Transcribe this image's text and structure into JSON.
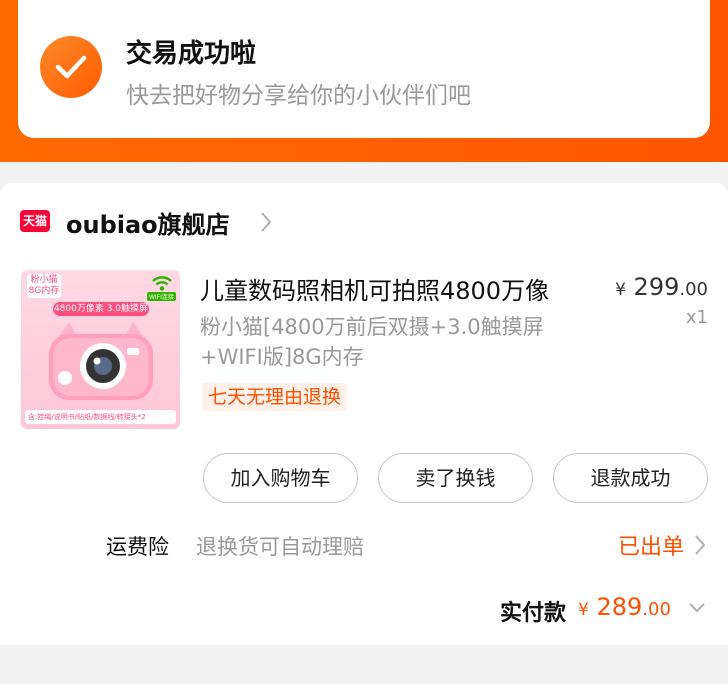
{
  "success": {
    "title": "交易成功啦",
    "subtitle": "快去把好物分享给你的小伙伴们吧"
  },
  "store": {
    "logo_text": "天猫",
    "name": "oubiao旗舰店"
  },
  "product": {
    "image": {
      "brand_line1": "粉小猫",
      "brand_line2": "8G内存",
      "badge": "4800万像素 3.0触摸屏",
      "wifi_label": "WIFI连接",
      "caption": "含:挂绳/说明书/贴纸/数据线/转接头*2"
    },
    "title": "儿童数码照相机可拍照4800万像",
    "sku": "粉小猫[4800万前后双摄+3.0触摸屏+WIFI版]8G内存",
    "return_tag": "七天无理由退换",
    "price_currency": "¥",
    "price_int": "299",
    "price_dec": ".00",
    "quantity": "x1"
  },
  "actions": {
    "add_to_cart": "加入购物车",
    "sell": "卖了换钱",
    "refund": "退款成功"
  },
  "insurance": {
    "label": "运费险",
    "description": "退换货可自动理赔",
    "status": "已出单"
  },
  "payment": {
    "label": "实付款",
    "currency": "¥",
    "amount_int": "289",
    "amount_dec": ".00"
  },
  "icons": {
    "success": "check-icon",
    "store_chevron": "chevron-right-icon",
    "insurance_chevron": "chevron-right-icon",
    "payment_chevron": "chevron-down-icon"
  },
  "colors": {
    "accent": "#ff5000",
    "tmall": "#ff0036"
  }
}
